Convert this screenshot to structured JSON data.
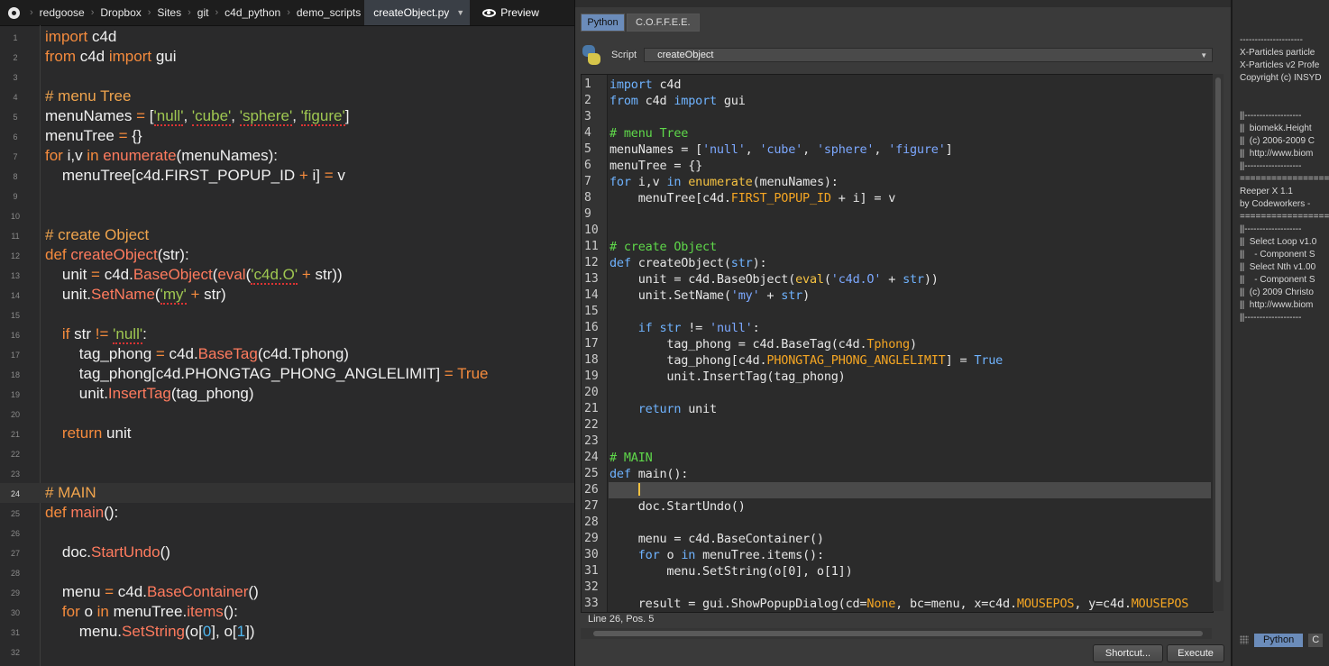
{
  "breadcrumb": {
    "items": [
      "redgoose",
      "Dropbox",
      "Sites",
      "git",
      "c4d_python",
      "demo_scripts"
    ],
    "active_file": "createObject.py",
    "preview_label": "Preview"
  },
  "left_editor": {
    "active_line": 24,
    "lines": [
      [
        [
          "kw",
          "import"
        ],
        [
          "t",
          " c4d"
        ]
      ],
      [
        [
          "kw",
          "from"
        ],
        [
          "t",
          " c4d "
        ],
        [
          "kw",
          "import"
        ],
        [
          "t",
          " gui"
        ]
      ],
      [],
      [
        [
          "cm",
          "# menu Tree"
        ]
      ],
      [
        [
          "t",
          "menuNames "
        ],
        [
          "kw",
          "="
        ],
        [
          "t",
          " ["
        ],
        [
          "str",
          "'null'"
        ],
        [
          "t",
          ", "
        ],
        [
          "str",
          "'cube'"
        ],
        [
          "t",
          ", "
        ],
        [
          "str",
          "'sphere'"
        ],
        [
          "t",
          ", "
        ],
        [
          "str",
          "'figure'"
        ],
        [
          "t",
          "]"
        ]
      ],
      [
        [
          "t",
          "menuTree "
        ],
        [
          "kw",
          "="
        ],
        [
          "t",
          " {}"
        ]
      ],
      [
        [
          "kw",
          "for"
        ],
        [
          "t",
          " i,v "
        ],
        [
          "kw",
          "in"
        ],
        [
          "t",
          " "
        ],
        [
          "fn",
          "enumerate"
        ],
        [
          "t",
          "(menuNames):"
        ]
      ],
      [
        [
          "t",
          "    menuTree[c4d.FIRST_POPUP_ID "
        ],
        [
          "kw",
          "+"
        ],
        [
          "t",
          " i] "
        ],
        [
          "kw",
          "="
        ],
        [
          "t",
          " v"
        ]
      ],
      [],
      [],
      [
        [
          "cm",
          "# create Object"
        ]
      ],
      [
        [
          "kw",
          "def"
        ],
        [
          "t",
          " "
        ],
        [
          "fn",
          "createObject"
        ],
        [
          "t",
          "(str):"
        ]
      ],
      [
        [
          "t",
          "    unit "
        ],
        [
          "kw",
          "="
        ],
        [
          "t",
          " c4d."
        ],
        [
          "fn",
          "BaseObject"
        ],
        [
          "t",
          "("
        ],
        [
          "fn",
          "eval"
        ],
        [
          "t",
          "("
        ],
        [
          "str",
          "'c4d.O'"
        ],
        [
          "t",
          " "
        ],
        [
          "kw",
          "+"
        ],
        [
          "t",
          " str))"
        ]
      ],
      [
        [
          "t",
          "    unit."
        ],
        [
          "fn",
          "SetName"
        ],
        [
          "t",
          "("
        ],
        [
          "str",
          "'my'"
        ],
        [
          "t",
          " "
        ],
        [
          "kw",
          "+"
        ],
        [
          "t",
          " str)"
        ]
      ],
      [],
      [
        [
          "t",
          "    "
        ],
        [
          "kw",
          "if"
        ],
        [
          "t",
          " str "
        ],
        [
          "kw",
          "!="
        ],
        [
          "t",
          " "
        ],
        [
          "str",
          "'null'"
        ],
        [
          "t",
          ":"
        ]
      ],
      [
        [
          "t",
          "        tag_phong "
        ],
        [
          "kw",
          "="
        ],
        [
          "t",
          " c4d."
        ],
        [
          "fn",
          "BaseTag"
        ],
        [
          "t",
          "(c4d.Tphong)"
        ]
      ],
      [
        [
          "t",
          "        tag_phong[c4d.PHONGTAG_PHONG_ANGLELIMIT] "
        ],
        [
          "kw",
          "="
        ],
        [
          "t",
          " "
        ],
        [
          "kw",
          "True"
        ]
      ],
      [
        [
          "t",
          "        unit."
        ],
        [
          "fn",
          "InsertTag"
        ],
        [
          "t",
          "(tag_phong)"
        ]
      ],
      [],
      [
        [
          "t",
          "    "
        ],
        [
          "kw",
          "return"
        ],
        [
          "t",
          " unit"
        ]
      ],
      [],
      [],
      [
        [
          "cm",
          "# MAIN"
        ]
      ],
      [
        [
          "kw",
          "def"
        ],
        [
          "t",
          " "
        ],
        [
          "fn",
          "main"
        ],
        [
          "t",
          "():"
        ]
      ],
      [],
      [
        [
          "t",
          "    doc."
        ],
        [
          "fn",
          "StartUndo"
        ],
        [
          "t",
          "()"
        ]
      ],
      [],
      [
        [
          "t",
          "    menu "
        ],
        [
          "kw",
          "="
        ],
        [
          "t",
          " c4d."
        ],
        [
          "fn",
          "BaseContainer"
        ],
        [
          "t",
          "()"
        ]
      ],
      [
        [
          "t",
          "    "
        ],
        [
          "kw",
          "for"
        ],
        [
          "t",
          " o "
        ],
        [
          "kw",
          "in"
        ],
        [
          "t",
          " menuTree."
        ],
        [
          "fn",
          "items"
        ],
        [
          "t",
          "():"
        ]
      ],
      [
        [
          "t",
          "        menu."
        ],
        [
          "fn",
          "SetString"
        ],
        [
          "t",
          "(o["
        ],
        [
          "num",
          "0"
        ],
        [
          "t",
          "], o["
        ],
        [
          "num",
          "1"
        ],
        [
          "t",
          "])"
        ]
      ],
      []
    ]
  },
  "script_manager": {
    "tabs": [
      "Python",
      "C.O.F.F.E.E."
    ],
    "script_label": "Script",
    "script_name": "createObject",
    "status": "Line 26, Pos. 5",
    "shortcut_label": "Shortcut...",
    "execute_label": "Execute",
    "active_line": 26,
    "lines": [
      [
        [
          "kw",
          "import"
        ],
        [
          "t",
          " c4d"
        ]
      ],
      [
        [
          "kw",
          "from"
        ],
        [
          "t",
          " c4d "
        ],
        [
          "kw",
          "import"
        ],
        [
          "t",
          " gui"
        ]
      ],
      [],
      [
        [
          "cm",
          "# menu Tree"
        ]
      ],
      [
        [
          "t",
          "menuNames = ["
        ],
        [
          "str",
          "'null'"
        ],
        [
          "t",
          ", "
        ],
        [
          "str",
          "'cube'"
        ],
        [
          "t",
          ", "
        ],
        [
          "str",
          "'sphere'"
        ],
        [
          "t",
          ", "
        ],
        [
          "str",
          "'figure'"
        ],
        [
          "t",
          "]"
        ]
      ],
      [
        [
          "t",
          "menuTree = {}"
        ]
      ],
      [
        [
          "kw",
          "for"
        ],
        [
          "t",
          " i,v "
        ],
        [
          "kw",
          "in"
        ],
        [
          "t",
          " "
        ],
        [
          "fn",
          "enumerate"
        ],
        [
          "t",
          "(menuNames):"
        ]
      ],
      [
        [
          "t",
          "    menuTree[c4d."
        ],
        [
          "const",
          "FIRST_POPUP_ID"
        ],
        [
          "t",
          " + i] = v"
        ]
      ],
      [],
      [],
      [
        [
          "cm",
          "# create Object"
        ]
      ],
      [
        [
          "kw",
          "def"
        ],
        [
          "t",
          " createObject("
        ],
        [
          "kw",
          "str"
        ],
        [
          "t",
          "):"
        ]
      ],
      [
        [
          "t",
          "    unit = c4d.BaseObject("
        ],
        [
          "fn",
          "eval"
        ],
        [
          "t",
          "("
        ],
        [
          "str",
          "'c4d.O'"
        ],
        [
          "t",
          " + "
        ],
        [
          "kw",
          "str"
        ],
        [
          "t",
          "))"
        ]
      ],
      [
        [
          "t",
          "    unit.SetName("
        ],
        [
          "str",
          "'my'"
        ],
        [
          "t",
          " + "
        ],
        [
          "kw",
          "str"
        ],
        [
          "t",
          ")"
        ]
      ],
      [],
      [
        [
          "t",
          "    "
        ],
        [
          "kw",
          "if"
        ],
        [
          "t",
          " "
        ],
        [
          "kw",
          "str"
        ],
        [
          "t",
          " != "
        ],
        [
          "str",
          "'null'"
        ],
        [
          "t",
          ":"
        ]
      ],
      [
        [
          "t",
          "        tag_phong = c4d.BaseTag(c4d."
        ],
        [
          "const",
          "Tphong"
        ],
        [
          "t",
          ")"
        ]
      ],
      [
        [
          "t",
          "        tag_phong[c4d."
        ],
        [
          "const",
          "PHONGTAG_PHONG_ANGLELIMIT"
        ],
        [
          "t",
          "] = "
        ],
        [
          "kw",
          "True"
        ]
      ],
      [
        [
          "t",
          "        unit.InsertTag(tag_phong)"
        ]
      ],
      [],
      [
        [
          "t",
          "    "
        ],
        [
          "kw",
          "return"
        ],
        [
          "t",
          " unit"
        ]
      ],
      [],
      [],
      [
        [
          "cm",
          "# MAIN"
        ]
      ],
      [
        [
          "kw",
          "def"
        ],
        [
          "t",
          " main():"
        ]
      ],
      [
        [
          "t",
          "    "
        ],
        [
          "caret",
          ""
        ]
      ],
      [
        [
          "t",
          "    doc.StartUndo()"
        ]
      ],
      [],
      [
        [
          "t",
          "    menu = c4d.BaseContainer()"
        ]
      ],
      [
        [
          "t",
          "    "
        ],
        [
          "kw",
          "for"
        ],
        [
          "t",
          " o "
        ],
        [
          "kw",
          "in"
        ],
        [
          "t",
          " menuTree.items():"
        ]
      ],
      [
        [
          "t",
          "        menu.SetString(o[0], o[1])"
        ]
      ],
      [],
      [
        [
          "t",
          "    result = gui.ShowPopupDialog(cd="
        ],
        [
          "const",
          "None"
        ],
        [
          "t",
          ", bc=menu, x=c4d."
        ],
        [
          "const",
          "MOUSEPOS"
        ],
        [
          "t",
          ", y=c4d."
        ],
        [
          "const",
          "MOUSEPOS"
        ]
      ]
    ]
  },
  "console": {
    "lines": [
      "---------------------",
      "X-Particles particle",
      "X-Particles v2 Profe",
      "Copyright (c) INSYD",
      "",
      "",
      "||-------------------",
      "||  biomekk.Height",
      "||  (c) 2006-2009 C",
      "||  http://www.biom",
      "||-------------------",
      "====================",
      "Reeper X 1.1",
      "by Codeworkers - ",
      "====================",
      "||-------------------",
      "||  Select Loop v1.0",
      "||    - Component S",
      "||  Select Nth v1.00",
      "||    - Component S",
      "||  (c) 2009 Christo",
      "||  http://www.biom",
      "||-------------------"
    ],
    "tabs": [
      "Python",
      "C"
    ]
  },
  "colors": {
    "left_keyword": "#f58b3d",
    "left_string": "#9fc751",
    "left_function": "#ff7b5e",
    "right_keyword": "#6fb3ff",
    "right_comment": "#5fd84a",
    "tab_active": "#6b8cba"
  }
}
